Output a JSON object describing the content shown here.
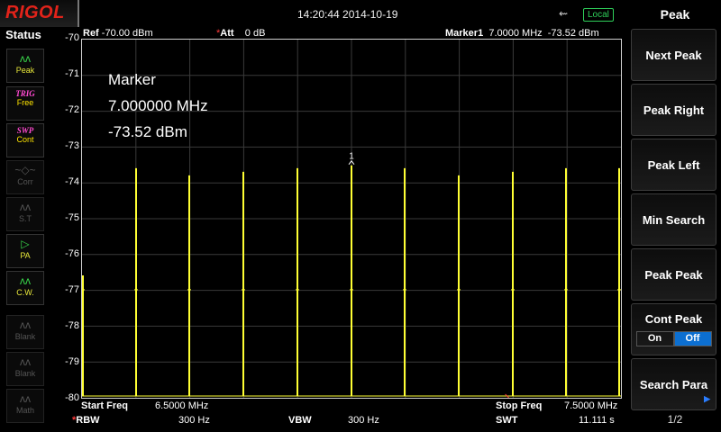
{
  "header": {
    "logo": "RIGOL",
    "datetime": "14:20:44 2014-10-19",
    "usb_icon": "usb-icon",
    "local_label": "Local"
  },
  "sidebar": {
    "title": "Status",
    "items": [
      {
        "icon": "peak-icon",
        "glyph": "ᴧᴧ",
        "label": "Peak",
        "state": "on"
      },
      {
        "icon": "trigger-icon",
        "glyph": "TRIG",
        "label": "Free",
        "state": "on"
      },
      {
        "icon": "sweep-icon",
        "glyph": "SWP",
        "label": "Cont",
        "state": "on"
      },
      {
        "icon": "correction-icon",
        "glyph": "~◇~",
        "label": "Corr",
        "state": "off"
      },
      {
        "icon": "signal-track-icon",
        "glyph": "ᴧᴧ",
        "label": "S.T",
        "state": "off"
      },
      {
        "icon": "preamp-icon",
        "glyph": "▷",
        "label": "PA",
        "state": "on"
      },
      {
        "icon": "clear-write-icon",
        "glyph": "ᴧᴧ",
        "label": "C.W.",
        "state": "on"
      },
      {
        "icon": "blank-icon",
        "glyph": "ᴧᴧ",
        "label": "Blank",
        "state": "off"
      },
      {
        "icon": "blank-icon",
        "glyph": "ᴧᴧ",
        "label": "Blank",
        "state": "off"
      },
      {
        "icon": "math-icon",
        "glyph": "ᴧᴧ",
        "label": "Math",
        "state": "off"
      }
    ]
  },
  "measurement": {
    "ref_label": "Ref",
    "ref_value": "-70.00 dBm",
    "att_label": "Att",
    "att_value": "0 dB",
    "marker_label": "Marker1",
    "marker_freq": "7.0000 MHz",
    "marker_level": "-73.52 dBm"
  },
  "marker_box": {
    "title": "Marker",
    "freq": "7.000000 MHz",
    "level": "-73.52 dBm",
    "marker_number": "1"
  },
  "footer": {
    "start_label": "Start Freq",
    "start_value": "6.5000 MHz",
    "stop_label": "Stop Freq",
    "stop_value": "7.5000 MHz",
    "rbw_label": "RBW",
    "rbw_value": "300 Hz",
    "vbw_label": "VBW",
    "vbw_value": "300 Hz",
    "swt_label": "SWT",
    "swt_value": "11.111 s"
  },
  "softkeys": {
    "title": "Peak",
    "buttons": [
      "Next Peak",
      "Peak Right",
      "Peak Left",
      "Min Search",
      "Peak Peak"
    ],
    "cont_peak": {
      "label": "Cont Peak",
      "on": "On",
      "off": "Off",
      "active": "Off"
    },
    "search_para": "Search Para",
    "page": "1/2"
  },
  "colors": {
    "trace": "#ffff33",
    "grid": "#3a3a3a",
    "marker_red": "#ff3b3b",
    "softkey_active": "#0c6fd1"
  },
  "chart_data": {
    "type": "line",
    "x_unit": "MHz",
    "y_unit": "dBm",
    "xlim": [
      6.5,
      7.5
    ],
    "ylim": [
      -80,
      -70
    ],
    "y_ticks": [
      "-70",
      "-71",
      "-72",
      "-73",
      "-74",
      "-75",
      "-76",
      "-77",
      "-78",
      "-79",
      "-80"
    ],
    "grid": true,
    "series": [
      {
        "spikes_x": [
          6.5,
          6.6,
          6.7,
          6.8,
          6.9,
          7.0,
          7.1,
          7.2,
          7.3,
          7.4,
          7.5
        ],
        "spikes_y": [
          -76.6,
          -73.6,
          -73.8,
          -73.7,
          -73.6,
          -73.52,
          -73.6,
          -73.8,
          -73.7,
          -73.6,
          -73.6
        ],
        "floor": -80
      }
    ],
    "marker": {
      "x": 7.0,
      "y": -73.52
    }
  }
}
